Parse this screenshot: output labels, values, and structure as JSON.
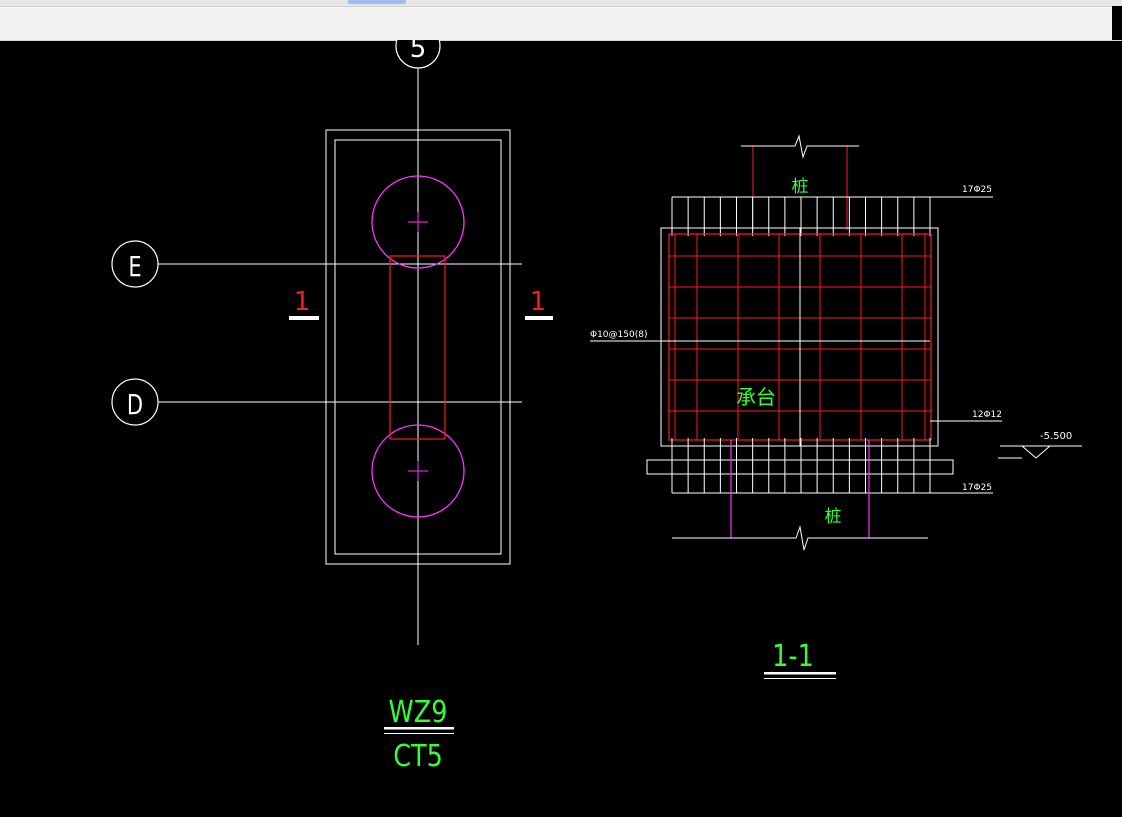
{
  "colors": {
    "background": "#000000",
    "outline": "#ffffff",
    "rebar": "#ff1a1a",
    "pile": "#ff33ff",
    "label": "#33ff33",
    "chrome": "#f2f2f2"
  },
  "plan": {
    "grid_top_bubble": "5",
    "grid_e": "E",
    "grid_d": "D",
    "section_mark_left": "1",
    "section_mark_right": "1",
    "title_top": "WZ9",
    "title_bottom": "CT5"
  },
  "section": {
    "pile_top_label": "桩",
    "pile_bottom_label": "桩",
    "cap_label": "承台",
    "top_bars": "17Φ25",
    "bottom_bars": "17Φ25",
    "stirrups": "Φ10@150(8)",
    "side_bars": "12Φ12",
    "elevation": "-5.500",
    "title": "1-1"
  }
}
